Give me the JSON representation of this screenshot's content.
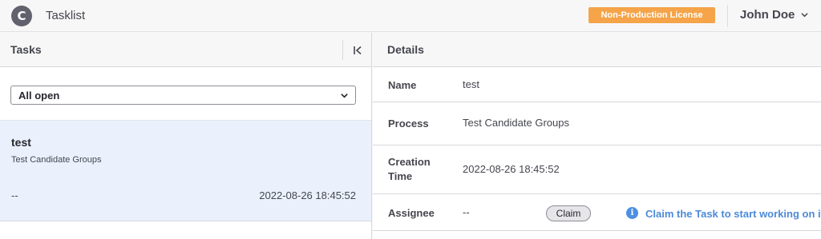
{
  "header": {
    "logo_letter": "C",
    "app_title": "Tasklist",
    "license_badge": "Non-Production License",
    "user_name": "John Doe",
    "accent_color": "#f5a449"
  },
  "tasks_panel": {
    "title": "Tasks",
    "collapse_icon": "collapse-left-icon",
    "filter": {
      "selected": "All open"
    },
    "items": [
      {
        "name": "test",
        "process": "Test Candidate Groups",
        "assignee": "--",
        "created": "2022-08-26 18:45:52",
        "selected": true
      }
    ]
  },
  "details_panel": {
    "title": "Details",
    "rows": [
      {
        "label": "Name",
        "value": "test"
      },
      {
        "label": "Process",
        "value": "Test Candidate Groups"
      },
      {
        "label_line1": "Creation",
        "label_line2": "Time",
        "value": "2022-08-26 18:45:52"
      },
      {
        "label": "Assignee",
        "value": "--"
      }
    ],
    "claim_button": "Claim",
    "claim_hint": "Claim the Task to start working on it",
    "info_icon": "info-icon"
  }
}
